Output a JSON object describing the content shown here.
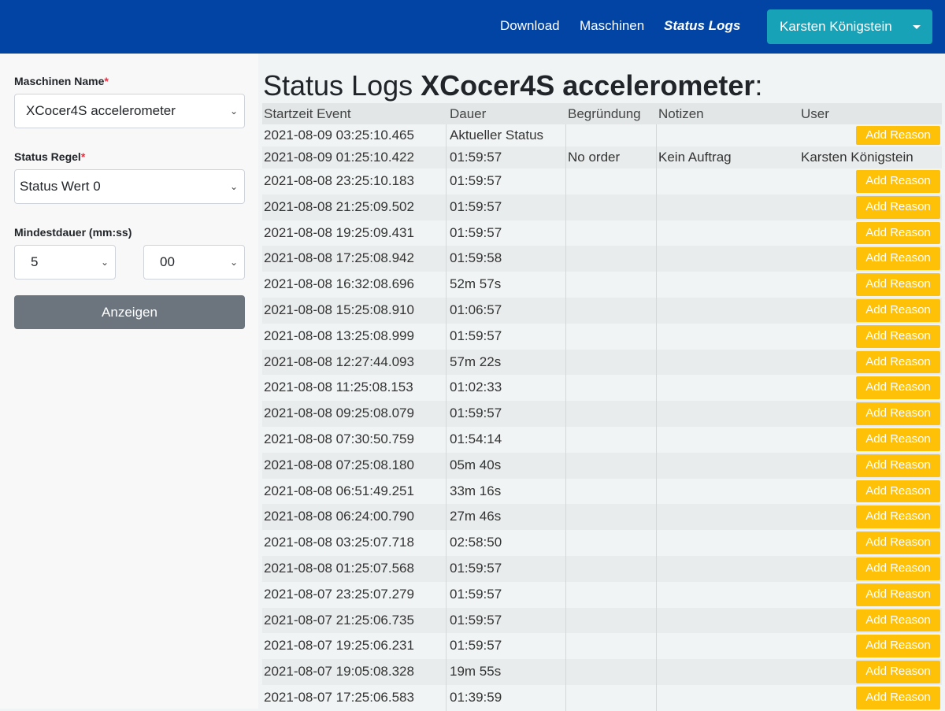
{
  "nav": {
    "links": [
      {
        "label": "Download"
      },
      {
        "label": "Maschinen"
      },
      {
        "label": "Status Logs"
      }
    ],
    "user": "Karsten Königstein"
  },
  "form": {
    "machine_label": "Maschinen Name",
    "machine_value": "XCocer4S accelerometer",
    "rule_label": "Status Regel",
    "rule_value": "Status Wert 0",
    "duration_label": "Mindestdauer (mm:ss)",
    "minutes_value": "5",
    "seconds_value": "00",
    "required_mark": "*",
    "submit_label": "Anzeigen"
  },
  "page": {
    "title_prefix": "Status Logs",
    "title_machine": "XCocer4S accelerometer",
    "title_suffix": ":"
  },
  "table": {
    "headers": [
      "Startzeit Event",
      "Dauer",
      "Begründung",
      "Notizen",
      "User"
    ],
    "button_label": "Add Reason",
    "rows": [
      {
        "start": "2021-08-09 03:25:10.465",
        "duration": "Aktueller Status",
        "reason": "",
        "notes": "",
        "user": "",
        "button": true
      },
      {
        "start": "2021-08-09 01:25:10.422",
        "duration": "01:59:57",
        "reason": "No order",
        "notes": "Kein Auftrag",
        "user": "Karsten Königstein",
        "button": false
      },
      {
        "start": "2021-08-08 23:25:10.183",
        "duration": "01:59:57",
        "reason": "",
        "notes": "",
        "user": "",
        "button": true
      },
      {
        "start": "2021-08-08 21:25:09.502",
        "duration": "01:59:57",
        "reason": "",
        "notes": "",
        "user": "",
        "button": true
      },
      {
        "start": "2021-08-08 19:25:09.431",
        "duration": "01:59:57",
        "reason": "",
        "notes": "",
        "user": "",
        "button": true
      },
      {
        "start": "2021-08-08 17:25:08.942",
        "duration": "01:59:58",
        "reason": "",
        "notes": "",
        "user": "",
        "button": true
      },
      {
        "start": "2021-08-08 16:32:08.696",
        "duration": "52m 57s",
        "reason": "",
        "notes": "",
        "user": "",
        "button": true
      },
      {
        "start": "2021-08-08 15:25:08.910",
        "duration": "01:06:57",
        "reason": "",
        "notes": "",
        "user": "",
        "button": true
      },
      {
        "start": "2021-08-08 13:25:08.999",
        "duration": "01:59:57",
        "reason": "",
        "notes": "",
        "user": "",
        "button": true
      },
      {
        "start": "2021-08-08 12:27:44.093",
        "duration": "57m 22s",
        "reason": "",
        "notes": "",
        "user": "",
        "button": true
      },
      {
        "start": "2021-08-08 11:25:08.153",
        "duration": "01:02:33",
        "reason": "",
        "notes": "",
        "user": "",
        "button": true
      },
      {
        "start": "2021-08-08 09:25:08.079",
        "duration": "01:59:57",
        "reason": "",
        "notes": "",
        "user": "",
        "button": true
      },
      {
        "start": "2021-08-08 07:30:50.759",
        "duration": "01:54:14",
        "reason": "",
        "notes": "",
        "user": "",
        "button": true
      },
      {
        "start": "2021-08-08 07:25:08.180",
        "duration": "05m 40s",
        "reason": "",
        "notes": "",
        "user": "",
        "button": true
      },
      {
        "start": "2021-08-08 06:51:49.251",
        "duration": "33m 16s",
        "reason": "",
        "notes": "",
        "user": "",
        "button": true
      },
      {
        "start": "2021-08-08 06:24:00.790",
        "duration": "27m 46s",
        "reason": "",
        "notes": "",
        "user": "",
        "button": true
      },
      {
        "start": "2021-08-08 03:25:07.718",
        "duration": "02:58:50",
        "reason": "",
        "notes": "",
        "user": "",
        "button": true
      },
      {
        "start": "2021-08-08 01:25:07.568",
        "duration": "01:59:57",
        "reason": "",
        "notes": "",
        "user": "",
        "button": true
      },
      {
        "start": "2021-08-07 23:25:07.279",
        "duration": "01:59:57",
        "reason": "",
        "notes": "",
        "user": "",
        "button": true
      },
      {
        "start": "2021-08-07 21:25:06.735",
        "duration": "01:59:57",
        "reason": "",
        "notes": "",
        "user": "",
        "button": true
      },
      {
        "start": "2021-08-07 19:25:06.231",
        "duration": "01:59:57",
        "reason": "",
        "notes": "",
        "user": "",
        "button": true
      },
      {
        "start": "2021-08-07 19:05:08.328",
        "duration": "19m 55s",
        "reason": "",
        "notes": "",
        "user": "",
        "button": true
      },
      {
        "start": "2021-08-07 17:25:06.583",
        "duration": "01:39:59",
        "reason": "",
        "notes": "",
        "user": "",
        "button": true
      }
    ]
  },
  "colors": {
    "navbar": "#0244a3",
    "user_button": "#17a2b8",
    "submit_button": "#6c757d",
    "add_reason": "#ffc107",
    "row_even": "#e9ecec",
    "row_odd": "#f1f4f4"
  }
}
